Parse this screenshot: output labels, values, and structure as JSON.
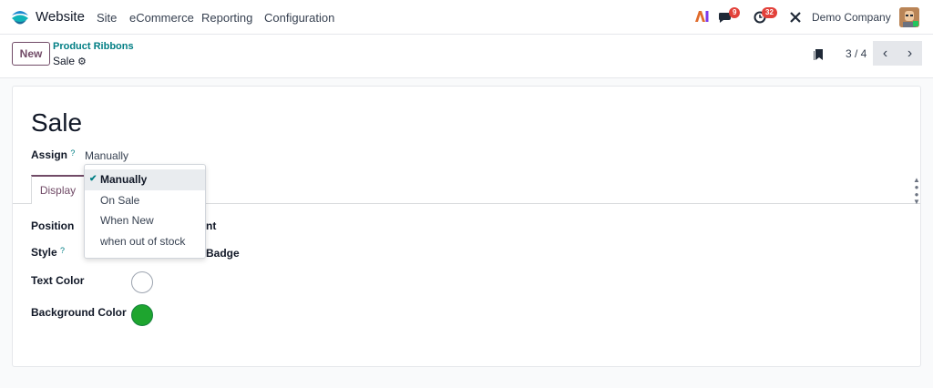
{
  "navbar": {
    "app_name": "Website",
    "menu": [
      "Site",
      "eCommerce",
      "Reporting",
      "Configuration"
    ],
    "messages_count": "9",
    "activities_count": "32",
    "company": "Demo Company"
  },
  "control_panel": {
    "new_label": "New",
    "breadcrumb_parent": "Product Ribbons",
    "breadcrumb_current": "Sale",
    "pager_value": "3 / 4"
  },
  "form": {
    "title": "Sale",
    "assign_label": "Assign",
    "help_mark": "?",
    "assign_value": "Manually",
    "tab_display": "Display",
    "position_label": "Position",
    "position_value_partial": "nt",
    "style_label": "Style",
    "style_value_partial": "Badge",
    "text_color_label": "Text Color",
    "text_color": "#ffffff",
    "background_color_label": "Background Color",
    "background_color": "#1ea52f"
  },
  "dropdown": {
    "options": [
      "Manually",
      "On Sale",
      "When New",
      "when out of stock"
    ],
    "selected_index": 0
  },
  "colors": {
    "brand": "#714b67",
    "accent": "#017e84",
    "badge": "#e2413a"
  }
}
